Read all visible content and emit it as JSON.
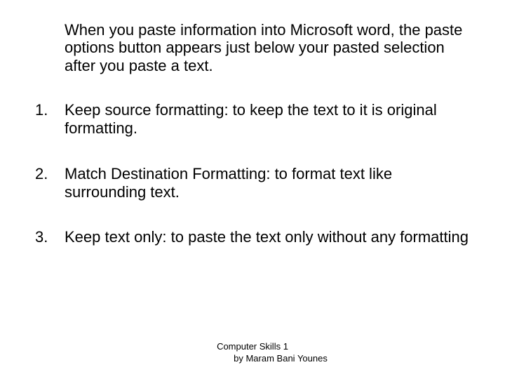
{
  "intro": "When you paste information into Microsoft word, the paste options button appears just below your pasted selection after you paste a text.",
  "items": [
    {
      "num": "1.",
      "text": "Keep source formatting: to keep the text to it is original formatting."
    },
    {
      "num": "2.",
      "text": "Match Destination Formatting: to format text like surrounding text."
    },
    {
      "num": "3.",
      "text": "Keep text only: to paste the text only without any formatting"
    }
  ],
  "footer": {
    "line1": "Computer Skills 1",
    "line2": "by Maram Bani Younes"
  }
}
